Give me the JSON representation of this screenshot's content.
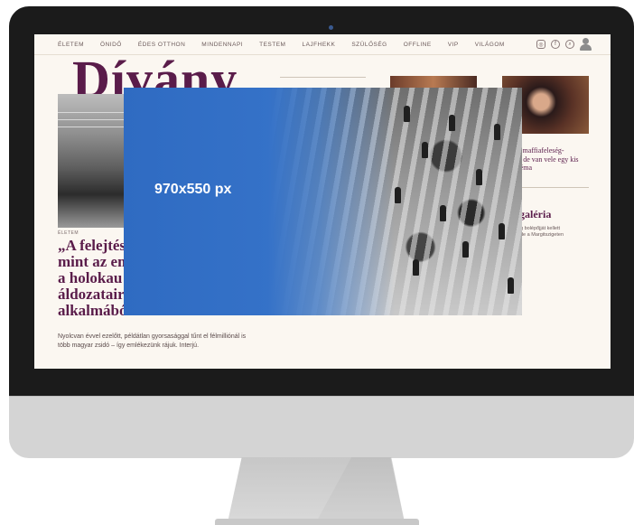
{
  "nav": {
    "items": [
      "ÉLETEM",
      "ÖNIDŐ",
      "ÉDES OTTHON",
      "MINDENNAPI",
      "TESTEM",
      "LAJFHEKK",
      "SZÜLŐSÉG",
      "OFFLINE",
      "VIP",
      "VILÁGOM"
    ],
    "icons": [
      "instagram-icon",
      "facebook-icon",
      "search-icon",
      "user-avatar-icon"
    ]
  },
  "site": {
    "logo": "Dívány"
  },
  "main_article": {
    "category": "ÉLETEM",
    "headline_lines": [
      "„A felejtés",
      "mint az em",
      "a holokau",
      "áldozatair",
      "alkalmából"
    ],
    "lead": "Nyolcvan évvel ezelőtt, példátlan gyorsasággal tűnt el félmillió­nál is több magyar zsidó – így emlékezünk rájuk. Interjú."
  },
  "side_article": {
    "headline_lines": [
      "a maffiafeleség-",
      "t, de van vele egy kis",
      "réma"
    ]
  },
  "gallery": {
    "title": "en  galéria",
    "lead_lines": [
      "g bolépőjját kellett",
      "de a Margitszigeten"
    ]
  },
  "ad": {
    "label": "970x550 px"
  },
  "colors": {
    "brand": "#5a1c4a",
    "ad_blue": "#3572c8",
    "page_bg": "#fbf7f1"
  }
}
